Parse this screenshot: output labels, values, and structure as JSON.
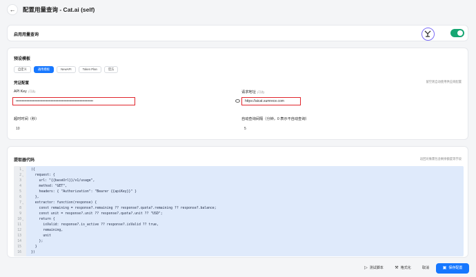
{
  "header": {
    "back": "←",
    "title": "配置用量查询 - Cat.ai (self)"
  },
  "enable": {
    "label": "启用用量查询",
    "enabled": true
  },
  "preset": {
    "title": "预设模板",
    "tabs": [
      {
        "label": "自定义",
        "active": false
      },
      {
        "label": "通用模板",
        "active": true
      },
      {
        "label": "NewAPI",
        "active": false
      },
      {
        "label": "Token Plan",
        "active": false
      },
      {
        "label": "官方",
        "active": false
      }
    ],
    "cred_title": "凭证配置",
    "cred_hint": "留空则自动使用供应商配置",
    "api_key": {
      "label": "API Key",
      "optional": "(可选)",
      "value": "••••••••••••••••••••••••••••••••••••••••••••••••••••••••••••••••"
    },
    "request_url": {
      "label": "请求地址",
      "optional": "(可选)",
      "value": "https://aicat.sumrece.com"
    },
    "timeout": {
      "label": "超时时间（秒）",
      "value": "10"
    },
    "auto_interval": {
      "label": "自动查询间隔（分钟，0 表示不自动查询）",
      "value": "5"
    }
  },
  "code": {
    "title": "提取器代码",
    "hint": "返回对象需包含剩余额度等字段",
    "lines": [
      {
        "n": "1",
        "fold": true,
        "text": "({"
      },
      {
        "n": "2",
        "fold": true,
        "text": "  request: {"
      },
      {
        "n": "3",
        "fold": false,
        "text": "    url: \"{{baseUrl}}/v1/usage\","
      },
      {
        "n": "4",
        "fold": false,
        "text": "    method: \"GET\","
      },
      {
        "n": "5",
        "fold": false,
        "text": "    headers: { \"Authorization\": \"Bearer {{apiKey}}\" }"
      },
      {
        "n": "6",
        "fold": false,
        "text": "  },"
      },
      {
        "n": "7",
        "fold": true,
        "text": "  extractor: function(response) {"
      },
      {
        "n": "8",
        "fold": false,
        "text": "    const remaining = response?.remaining ?? response?.quota?.remaining ?? response?.balance;"
      },
      {
        "n": "9",
        "fold": false,
        "text": "    const unit = response?.unit ?? response?.quota?.unit ?? \"USD\";"
      },
      {
        "n": "10",
        "fold": true,
        "text": "    return {"
      },
      {
        "n": "11",
        "fold": false,
        "text": "      isValid: response?.is_active ?? response?.isValid ?? true,"
      },
      {
        "n": "12",
        "fold": false,
        "text": "      remaining,"
      },
      {
        "n": "13",
        "fold": false,
        "text": "      unit"
      },
      {
        "n": "14",
        "fold": false,
        "text": "    };"
      },
      {
        "n": "15",
        "fold": false,
        "text": "  }"
      },
      {
        "n": "16",
        "fold": false,
        "text": "})"
      }
    ]
  },
  "footer": {
    "test": "测试脚本",
    "format": "格式化",
    "cancel": "取消",
    "save": "保存配置"
  },
  "colors": {
    "primary": "#1677ff",
    "toggle_on": "#17a673",
    "highlight_border": "#e0242b",
    "editor_bg": "#dfeafb"
  }
}
